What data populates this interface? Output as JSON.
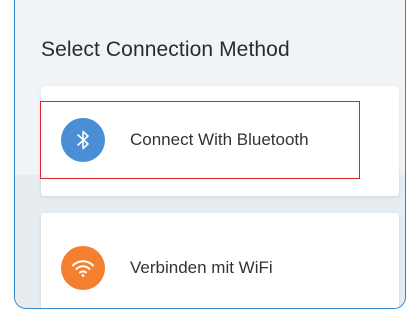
{
  "header": {
    "title": "Select Connection Method"
  },
  "options": [
    {
      "label": "Connect With Bluetooth",
      "icon": "bluetooth-icon",
      "icon_color": "#4a8ed6"
    },
    {
      "label": "Verbinden mit WiFi",
      "icon": "wifi-icon",
      "icon_color": "#f47f2e"
    }
  ],
  "highlight_color": "#d9262a",
  "frame_color": "#2c86cf"
}
